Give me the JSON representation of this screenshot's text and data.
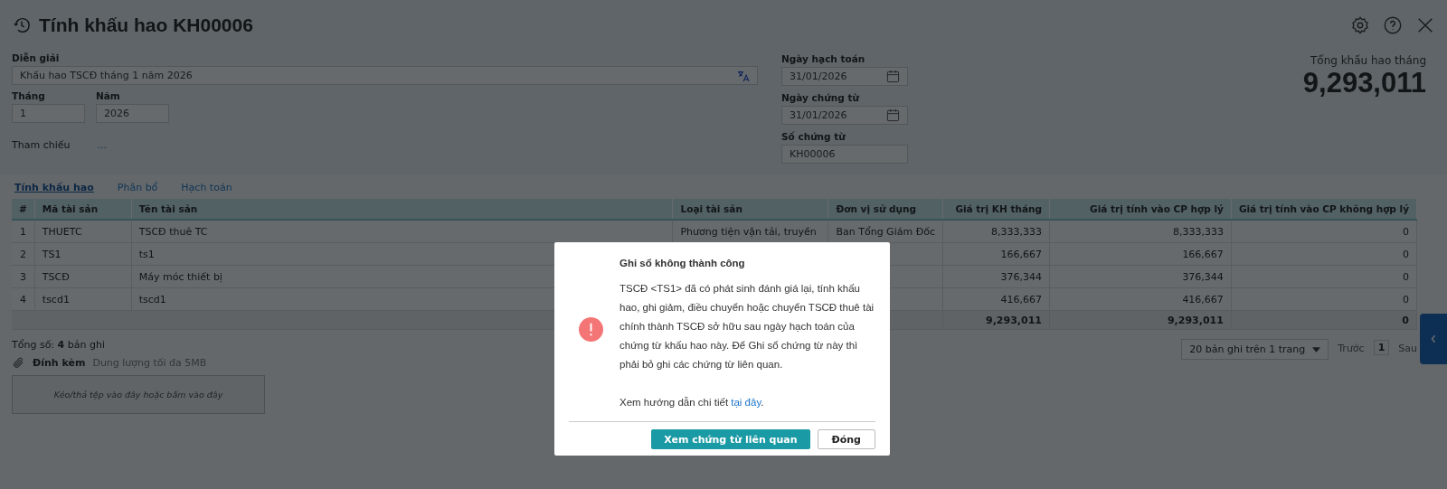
{
  "title": "Tính khấu hao KH00006",
  "form": {
    "description": {
      "label": "Diễn giải",
      "value": "Khấu hao TSCĐ tháng 1 năm 2026"
    },
    "month": {
      "label": "Tháng",
      "value": "1"
    },
    "year": {
      "label": "Năm",
      "value": "2026"
    },
    "reference": {
      "label": "Tham chiếu",
      "link": "..."
    },
    "posting_date": {
      "label": "Ngày hạch toán",
      "value": "31/01/2026"
    },
    "document_date": {
      "label": "Ngày chứng từ",
      "value": "31/01/2026"
    },
    "document_number": {
      "label": "Số chứng từ",
      "value": "KH00006"
    }
  },
  "summary": {
    "label": "Tổng khấu hao tháng",
    "value": "9,293,011"
  },
  "tabs": [
    {
      "label": "Tính khấu hao",
      "selected": true
    },
    {
      "label": "Phân bổ",
      "selected": false
    },
    {
      "label": "Hạch toán",
      "selected": false
    }
  ],
  "table": {
    "columns": [
      "#",
      "Mã tài sản",
      "Tên tài sản",
      "Loại tài sản",
      "Đơn vị sử dụng",
      "Giá trị KH tháng",
      "Giá trị tính vào CP hợp lý",
      "Giá trị tính vào CP không hợp lý"
    ],
    "rows": [
      {
        "index": "1",
        "code": "THUETC",
        "name": "TSCĐ thuê TC",
        "type": "Phương tiện vận tải, truyền",
        "unit": "Ban Tổng Giám Đốc",
        "monthly": "8,333,333",
        "reasonable": "8,333,333",
        "unreasonable": "0"
      },
      {
        "index": "2",
        "code": "TS1",
        "name": "ts1",
        "monthly": "166,667",
        "reasonable": "166,667",
        "unreasonable": "0"
      },
      {
        "index": "3",
        "code": "TSCĐ",
        "name": "Máy móc thiết bị",
        "monthly": "376,344",
        "reasonable": "376,344",
        "unreasonable": "0"
      },
      {
        "index": "4",
        "code": "tscd1",
        "name": "tscd1",
        "monthly": "416,667",
        "reasonable": "416,667",
        "unreasonable": "0"
      }
    ],
    "totals": {
      "monthly": "9,293,011",
      "reasonable": "9,293,011",
      "unreasonable": "0"
    }
  },
  "footer": {
    "count": "Tổng số: **4** bản ghi",
    "attachment_label": "Đính kèm",
    "attachment_hint": "Dung lượng tối đa 5MB",
    "dropzone": "Kéo/thả tệp vào đây hoặc bấm vào đây",
    "page_size": "20 bản ghi trên 1 trang",
    "prev": "Trước",
    "page": "1",
    "next": "Sau"
  },
  "dialog": {
    "title": "Ghi sổ không thành công",
    "message": "TSCĐ <TS1> đã có phát sinh đánh giá lại, tính khấu hao, ghi giảm, điều chuyển hoặc chuyển TSCĐ thuê tài chính thành TSCĐ sở hữu sau ngày hạch toán của chứng từ khấu hao này. Để Ghi sổ chứng từ này thì phải bỏ ghi các chứng từ liên quan.",
    "guide": "Xem hướng dẫn chi tiết",
    "guide_link": "tại đây",
    "guide_end": ".",
    "buttons": [
      {
        "label": "Xem chứng từ liên quan",
        "kind": "primary"
      },
      {
        "label": "Đóng",
        "kind": "secondary"
      }
    ]
  }
}
